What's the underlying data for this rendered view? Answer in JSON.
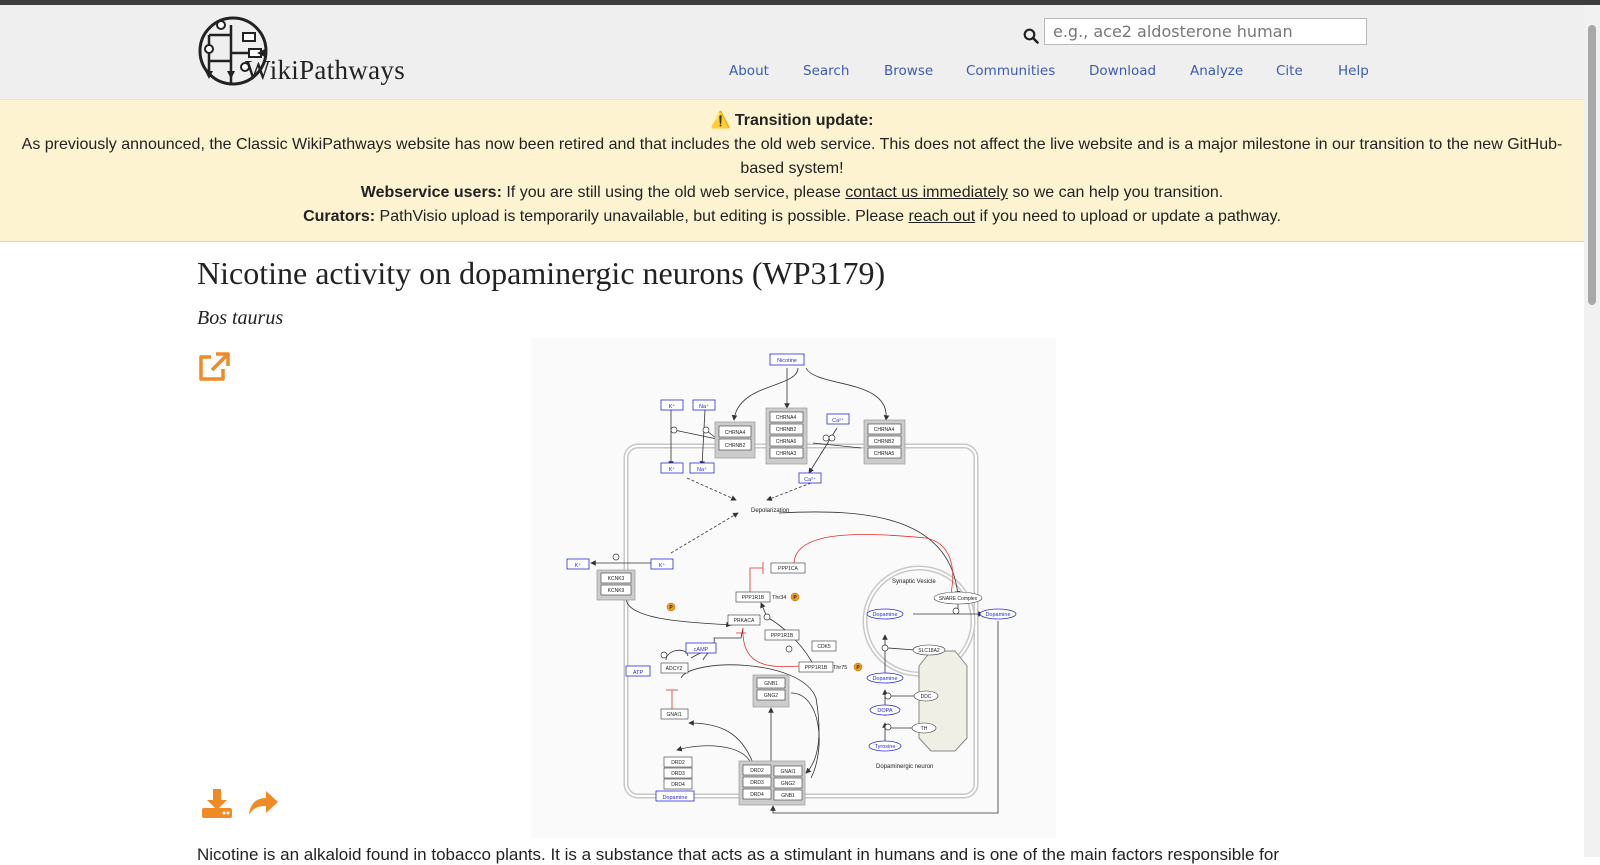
{
  "header": {
    "logo_text": "WikiPathways",
    "search_placeholder": "e.g., ace2 aldosterone human",
    "search_icon": "search-icon",
    "nav": [
      "About",
      "Search",
      "Browse",
      "Communities",
      "Download",
      "Analyze",
      "Cite",
      "Help"
    ]
  },
  "banner": {
    "title": "⚠️ Transition update:",
    "line1": "As previously announced, the Classic WikiPathways website has now been retired and that includes the old web service. This does not affect the live website and is a major milestone in our transition to the new GitHub-based system!",
    "webservice_label": "Webservice users:",
    "webservice_text1": "If you are still using the old web service, please",
    "webservice_link": "contact us immediately",
    "webservice_text2": "so we can help you transition.",
    "curators_label": "Curators:",
    "curators_text1": "PathVisio upload is temporarily unavailable, but editing is possible. Please",
    "curators_link": "reach out",
    "curators_text2": "if you need to upload or update a pathway."
  },
  "page": {
    "title": "Nicotine activity on dopaminergic neurons (WP3179)",
    "organism": "Bos taurus",
    "description": "Nicotine is an alkaloid found in tobacco plants. It is a substance that acts as a stimulant in humans and is one of the main factors responsible for"
  },
  "icons": {
    "open": "external-link-icon",
    "download": "download-icon",
    "share": "share-icon"
  },
  "colors": {
    "accent": "#f08a24",
    "nav_link": "#3b5cad",
    "banner_bg": "#fdf3d0",
    "metabolite": "#2b2bd6"
  },
  "diagram": {
    "nicotine": "Nicotine",
    "k_ion": "K⁺",
    "na_ion": "Na⁺",
    "ca_ion": "Ca²⁺",
    "chrna4": "CHRNA4",
    "chrnb2": "CHRNB2",
    "chrna6": "CHRNA6",
    "chrna3": "CHRNA3",
    "chrna5": "CHRNA5",
    "depolarization": "Depolarization",
    "kcnk3": "KCNK3",
    "kcnk9": "KCNK9",
    "ppp1ca": "PPP1CA",
    "ppp1r1b": "PPP1R1B",
    "thr34": "Thr34",
    "thr75": "Thr75",
    "phospho": "P",
    "prkaca": "PRKACA",
    "cdk5": "CDK5",
    "camp": "cAMP",
    "atp": "ATP",
    "adcy2": "ADCY2",
    "gnai1": "GNAI1",
    "gnb1": "GNB1",
    "gng2": "GNG2",
    "drd2": "DRD2",
    "drd3": "DRD3",
    "drd4": "DRD4",
    "dopamine": "Dopamine",
    "synaptic_vesicle": "Synaptic Vesicle",
    "snare": "SNARE Complex",
    "slc18a2": "SLC18A2",
    "ddc": "DDC",
    "th": "TH",
    "dopa": "DOPA",
    "tyrosine": "Tyrosine",
    "neuron": "Dopaminergic neuron"
  }
}
